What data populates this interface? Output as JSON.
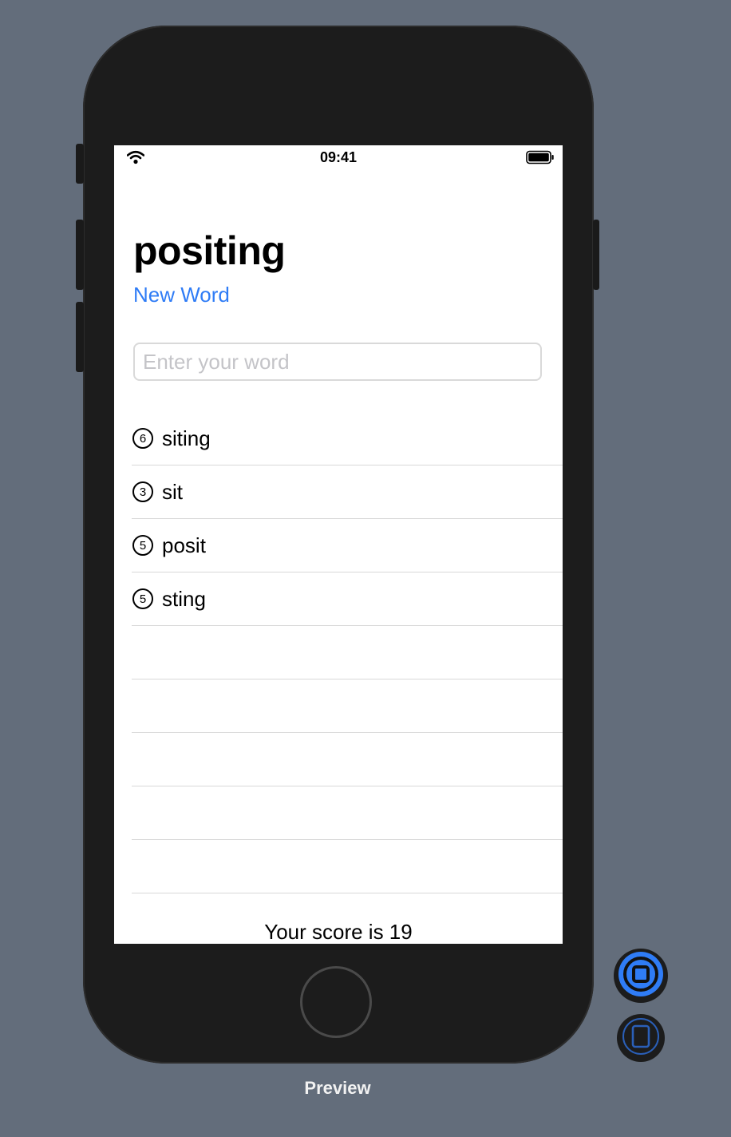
{
  "status_bar": {
    "time": "09:41",
    "wifi_icon": "wifi-icon",
    "battery_icon": "battery-icon"
  },
  "app": {
    "title": "positing",
    "new_word_label": "New Word",
    "input": {
      "placeholder": "Enter your word",
      "value": ""
    },
    "words": [
      {
        "count": "6",
        "word": "siting"
      },
      {
        "count": "3",
        "word": "sit"
      },
      {
        "count": "5",
        "word": "posit"
      },
      {
        "count": "5",
        "word": "sting"
      }
    ],
    "score_text": "Your score is 19"
  },
  "preview": {
    "label": "Preview",
    "live_preview_icon": "live-preview-icon",
    "device_icon": "device-icon"
  },
  "colors": {
    "accent": "#2f7cf6",
    "background": "#636d7b",
    "device_body": "#1c1c1c"
  }
}
